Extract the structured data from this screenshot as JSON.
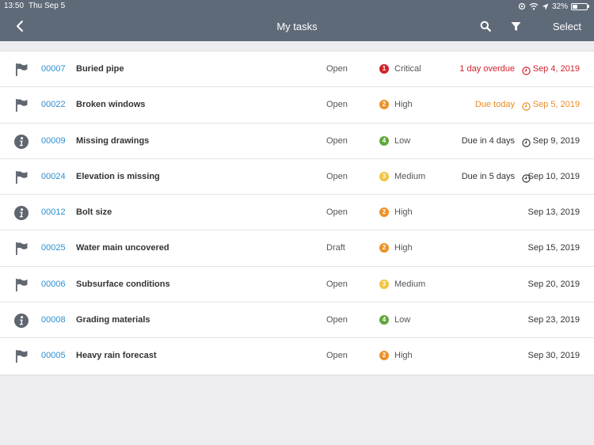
{
  "status_bar": {
    "time": "13:50",
    "date": "Thu Sep 5",
    "battery": "32%"
  },
  "header": {
    "title": "My tasks",
    "select_label": "Select"
  },
  "colors": {
    "header_bg": "#5f6a79",
    "link": "#2e8fd0",
    "critical": "#d0222c",
    "high": "#ec9127",
    "medium": "#f2c440",
    "low": "#62a73b",
    "overdue_text": "#d0222c",
    "due_today_text": "#ec8a1f"
  },
  "tasks": [
    {
      "type_icon": "flag-icon",
      "id": "00007",
      "name": "Buried pipe",
      "status": "Open",
      "priority_num": "1",
      "priority_label": "Critical",
      "priority_color": "#d0222c",
      "due_text": "1 day overdue",
      "due_color": "#d0222c",
      "show_clock": true,
      "due_date": "Sep 4, 2019"
    },
    {
      "type_icon": "flag-icon",
      "id": "00022",
      "name": "Broken windows",
      "status": "Open",
      "priority_num": "2",
      "priority_label": "High",
      "priority_color": "#ec9127",
      "due_text": "Due today",
      "due_color": "#ec8a1f",
      "show_clock": true,
      "due_date": "Sep 5, 2019"
    },
    {
      "type_icon": "info-icon",
      "id": "00009",
      "name": "Missing drawings",
      "status": "Open",
      "priority_num": "4",
      "priority_label": "Low",
      "priority_color": "#62a73b",
      "due_text": "Due in 4 days",
      "due_color": "#333333",
      "show_clock": true,
      "due_date": "Sep 9, 2019"
    },
    {
      "type_icon": "flag-icon",
      "id": "00024",
      "name": "Elevation is missing",
      "status": "Open",
      "priority_num": "3",
      "priority_label": "Medium",
      "priority_color": "#f2c440",
      "due_text": "Due in 5 days",
      "due_color": "#333333",
      "show_clock": true,
      "due_date": "Sep 10, 2019"
    },
    {
      "type_icon": "info-icon",
      "id": "00012",
      "name": "Bolt size",
      "status": "Open",
      "priority_num": "2",
      "priority_label": "High",
      "priority_color": "#ec9127",
      "due_text": "",
      "due_color": "#333333",
      "show_clock": false,
      "due_date": "Sep 13, 2019"
    },
    {
      "type_icon": "flag-icon",
      "id": "00025",
      "name": "Water main uncovered",
      "status": "Draft",
      "priority_num": "2",
      "priority_label": "High",
      "priority_color": "#ec9127",
      "due_text": "",
      "due_color": "#333333",
      "show_clock": false,
      "due_date": "Sep 15, 2019"
    },
    {
      "type_icon": "flag-icon",
      "id": "00006",
      "name": "Subsurface conditions",
      "status": "Open",
      "priority_num": "3",
      "priority_label": "Medium",
      "priority_color": "#f2c440",
      "due_text": "",
      "due_color": "#333333",
      "show_clock": false,
      "due_date": "Sep 20, 2019"
    },
    {
      "type_icon": "info-icon",
      "id": "00008",
      "name": "Grading materials",
      "status": "Open",
      "priority_num": "4",
      "priority_label": "Low",
      "priority_color": "#62a73b",
      "due_text": "",
      "due_color": "#333333",
      "show_clock": false,
      "due_date": "Sep 23, 2019"
    },
    {
      "type_icon": "flag-icon",
      "id": "00005",
      "name": "Heavy rain forecast",
      "status": "Open",
      "priority_num": "2",
      "priority_label": "High",
      "priority_color": "#ec9127",
      "due_text": "",
      "due_color": "#333333",
      "show_clock": false,
      "due_date": "Sep 30, 2019"
    }
  ]
}
